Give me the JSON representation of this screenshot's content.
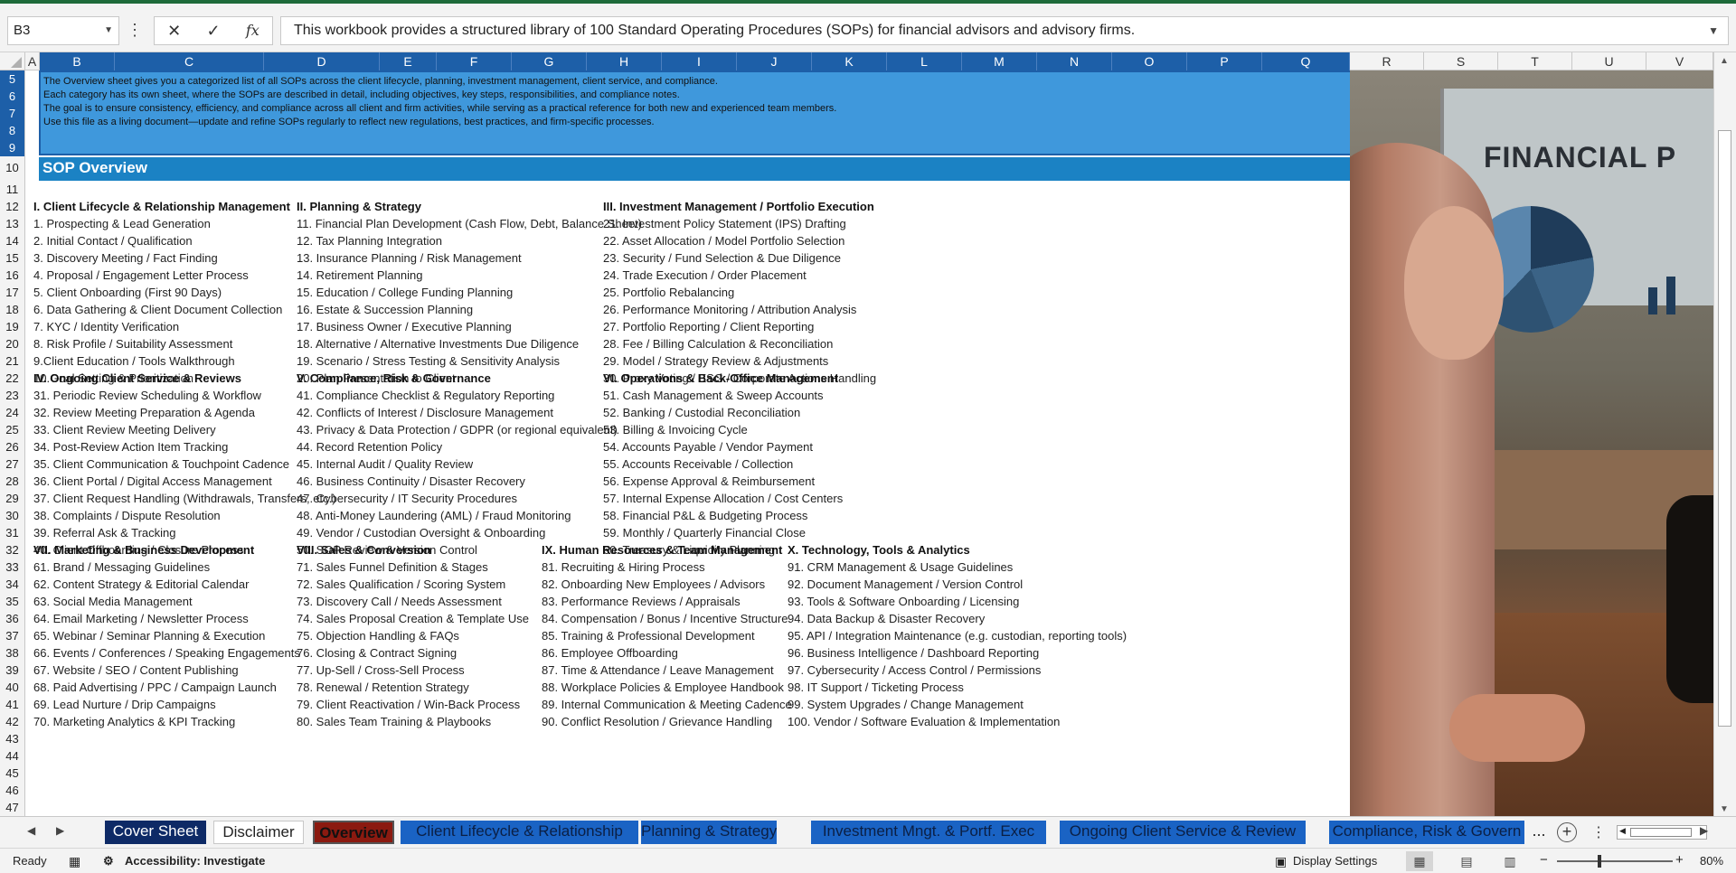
{
  "name_box": "B3",
  "formula_text": "This workbook provides a structured library of 100 Standard Operating Procedures (SOPs) for financial advisors and advisory firms.",
  "columns": [
    "A",
    "B",
    "C",
    "D",
    "E",
    "F",
    "G",
    "H",
    "I",
    "J",
    "K",
    "L",
    "M",
    "N",
    "O",
    "P",
    "Q",
    "R",
    "S",
    "T",
    "U",
    "V"
  ],
  "rows": [
    "5",
    "6",
    "7",
    "8",
    "9",
    "10",
    "11",
    "12",
    "13",
    "14",
    "15",
    "16",
    "17",
    "18",
    "19",
    "20",
    "21",
    "22",
    "23",
    "24",
    "25",
    "26",
    "27",
    "28",
    "29",
    "30",
    "31",
    "32",
    "33",
    "34",
    "35",
    "36",
    "37",
    "38",
    "39",
    "40",
    "41",
    "42",
    "43",
    "44",
    "45",
    "46",
    "47"
  ],
  "intro_lines": [
    "The Overview sheet gives you a categorized list of all SOPs across the client lifecycle, planning, investment management, client service, and compliance.",
    "Each category has its own sheet, where the SOPs are described in detail, including objectives, key steps, responsibilities, and compliance notes.",
    "The goal is to ensure consistency, efficiency, and compliance across all client and firm activities, while serving as a practical reference for both new and experienced team members.",
    "Use this file as a living document—update and refine SOPs regularly to reflect new regulations, best practices, and firm-specific processes."
  ],
  "banner_title": "SOP Overview",
  "sections": [
    {
      "heading": "I. Client Lifecycle & Relationship Management",
      "items": [
        "1. Prospecting & Lead Generation",
        "2. Initial Contact / Qualification",
        "3. Discovery Meeting / Fact Finding",
        "4. Proposal / Engagement Letter Process",
        "5. Client Onboarding (First 90 Days)",
        "6. Data Gathering & Client Document Collection",
        "7. KYC / Identity Verification",
        "8. Risk Profile / Suitability Assessment",
        "9.Client Education / Tools Walkthrough",
        "10.Goal Setting & Prioritization"
      ]
    },
    {
      "heading": "II. Planning & Strategy",
      "items": [
        "11. Financial Plan Development (Cash Flow, Debt, Balance Sheet)",
        "12. Tax Planning Integration",
        "13. Insurance Planning / Risk Management",
        "14. Retirement Planning",
        "15. Education / College Funding Planning",
        "16. Estate & Succession Planning",
        "17. Business Owner / Executive Planning",
        "18. Alternative / Alternative Investments Due Diligence",
        "19. Scenario / Stress Testing & Sensitivity Analysis",
        "20. Plan Presentation to Client"
      ]
    },
    {
      "heading": "III. Investment Management / Portfolio Execution",
      "items": [
        "21. Investment Policy Statement (IPS) Drafting",
        "22. Asset Allocation / Model Portfolio Selection",
        "23. Security / Fund Selection & Due Diligence",
        "24. Trade Execution / Order Placement",
        "25. Portfolio Rebalancing",
        "26. Performance Monitoring / Attribution Analysis",
        "27. Portfolio Reporting / Client Reporting",
        "28. Fee / Billing Calculation & Reconciliation",
        "29. Model / Strategy Review & Adjustments",
        "30. Proxy Voting / ESG / Corporate Actions Handling"
      ]
    },
    {
      "heading": "IV. Ongoing Client Service & Reviews",
      "items": [
        "31. Periodic Review Scheduling & Workflow",
        "32. Review Meeting Preparation & Agenda",
        "33. Client Review Meeting Delivery",
        "34. Post-Review Action Item Tracking",
        "35. Client Communication & Touchpoint Cadence",
        "36. Client Portal / Digital Access Management",
        "37. Client Request Handling (Withdrawals, Transfers, etc.)",
        "38. Complaints / Dispute Resolution",
        "39. Referral Ask & Tracking",
        "40. Client Offboarding / Closure Process"
      ]
    },
    {
      "heading": "V. Compliance, Risk & Governance",
      "items": [
        "41. Compliance Checklist & Regulatory Reporting",
        "42. Conflicts of Interest / Disclosure Management",
        "43. Privacy & Data Protection / GDPR (or regional equivalent)",
        "44. Record Retention Policy",
        "45. Internal Audit / Quality Review",
        "46. Business Continuity / Disaster Recovery",
        "47. Cybersecurity / IT Security Procedures",
        "48. Anti-Money Laundering (AML) / Fraud Monitoring",
        "49. Vendor / Custodian Oversight & Onboarding",
        "50. SOP Review & Version Control"
      ]
    },
    {
      "heading": "VI. Operations & Back-Office Management",
      "items": [
        "51. Cash Management & Sweep Accounts",
        "52. Banking / Custodial Reconciliation",
        "53. Billing & Invoicing Cycle",
        "54. Accounts Payable / Vendor Payment",
        "55. Accounts Receivable / Collection",
        "56. Expense Approval & Reimbursement",
        "57. Internal Expense Allocation / Cost Centers",
        "58. Financial P&L & Budgeting Process",
        "59. Monthly / Quarterly Financial Close",
        "60. Treasury & Liquidity Planning"
      ]
    },
    {
      "heading": "VII. Marketing & Business Development",
      "items": [
        "61. Brand / Messaging Guidelines",
        "62. Content Strategy & Editorial Calendar",
        "63. Social Media Management",
        "64. Email Marketing / Newsletter Process",
        "65. Webinar / Seminar Planning & Execution",
        "66. Events / Conferences / Speaking Engagements",
        "67. Website / SEO / Content Publishing",
        "68. Paid Advertising / PPC / Campaign Launch",
        "69. Lead Nurture / Drip Campaigns",
        "70. Marketing Analytics & KPI Tracking"
      ]
    },
    {
      "heading": "VIII. Sales & Conversion",
      "items": [
        "71. Sales Funnel Definition & Stages",
        "72. Sales Qualification / Scoring System",
        "73. Discovery Call / Needs Assessment",
        "74. Sales Proposal Creation & Template Use",
        "75. Objection Handling & FAQs",
        "76. Closing & Contract Signing",
        "77. Up-Sell / Cross-Sell Process",
        "78. Renewal / Retention Strategy",
        "79. Client Reactivation / Win-Back Process",
        "80. Sales Team Training & Playbooks"
      ]
    },
    {
      "heading": "IX. Human Resources & Team Management",
      "items": [
        "81. Recruiting & Hiring Process",
        "82. Onboarding New Employees / Advisors",
        "83. Performance Reviews / Appraisals",
        "84. Compensation / Bonus / Incentive Structure",
        "85. Training & Professional Development",
        "86. Employee Offboarding",
        "87. Time & Attendance / Leave Management",
        "88. Workplace Policies & Employee Handbook",
        "89. Internal Communication & Meeting Cadence",
        "90. Conflict Resolution / Grievance Handling"
      ]
    },
    {
      "heading": "X. Technology, Tools & Analytics",
      "items": [
        "91. CRM Management & Usage Guidelines",
        "92. Document Management / Version Control",
        "93. Tools & Software Onboarding / Licensing",
        "94. Data Backup & Disaster Recovery",
        "95. API / Integration Maintenance (e.g. custodian, reporting tools)",
        "96. Business Intelligence / Dashboard Reporting",
        "97. Cybersecurity / Access Control / Permissions",
        "98. IT Support / Ticketing Process",
        "99. System Upgrades / Change Management",
        "100. Vendor / Software Evaluation & Implementation"
      ]
    }
  ],
  "image_text": "FINANCIAL P",
  "sheet_tabs": [
    {
      "label": "Cover Sheet",
      "bg": "#0e2a66",
      "fg": "#ffffff"
    },
    {
      "label": "Disclaimer",
      "bg": "#ffffff",
      "fg": "#222222"
    },
    {
      "label": "Overview",
      "bg": "#8b1a10",
      "fg": "#111111"
    },
    {
      "label": "Client Lifecycle & Relationship",
      "bg": "#1a63c4",
      "fg": "#0b1f44"
    },
    {
      "label": "Planning & Strategy",
      "bg": "#1a63c4",
      "fg": "#0b1f44"
    },
    {
      "label": "Investment Mngt. & Portf. Exec",
      "bg": "#1a63c4",
      "fg": "#0b1f44"
    },
    {
      "label": "Ongoing Client Service & Review",
      "bg": "#1a63c4",
      "fg": "#0b1f44"
    },
    {
      "label": "Compliance, Risk & Govern",
      "bg": "#1a63c4",
      "fg": "#0b1f44"
    }
  ],
  "tab_overflow": "...",
  "status": {
    "ready": "Ready",
    "accessibility": "Accessibility: Investigate",
    "display_settings": "Display Settings",
    "zoom": "80%"
  }
}
